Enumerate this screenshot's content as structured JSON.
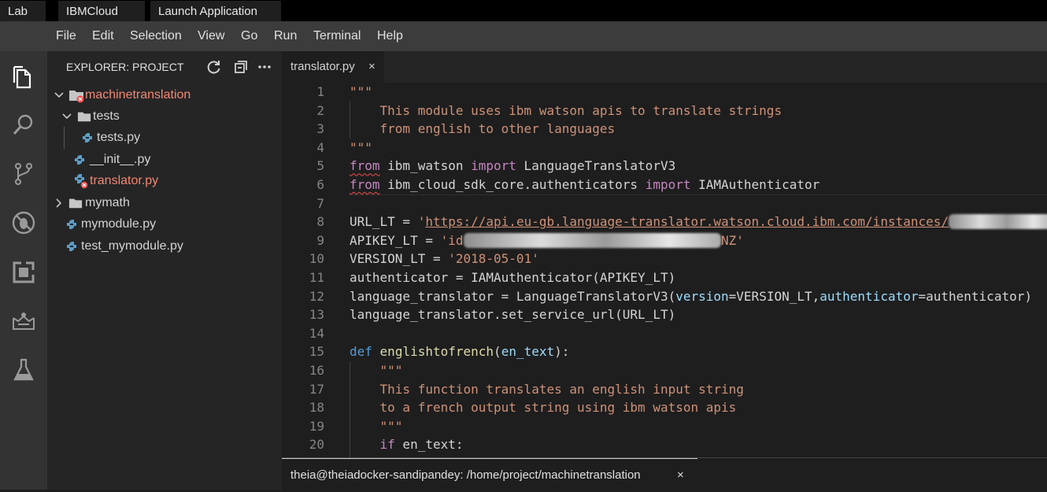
{
  "browser_tabs": [
    "Lab",
    "IBMCloud",
    "Launch Application"
  ],
  "menu": [
    "File",
    "Edit",
    "Selection",
    "View",
    "Go",
    "Run",
    "Terminal",
    "Help"
  ],
  "activity_icons": [
    "explorer-icon",
    "search-icon",
    "source-control-icon",
    "debug-icon",
    "extensions-icon",
    "toolbox-icon",
    "lab-flask-icon"
  ],
  "sidebar": {
    "title": "EXPLORER: PROJECT",
    "actions": [
      "refresh-icon",
      "collapse-all-icon",
      "more-icon"
    ],
    "tree": [
      {
        "label": "machinetranslation",
        "type": "folder",
        "expanded": true,
        "error": true
      },
      {
        "label": "tests",
        "type": "folder",
        "expanded": true,
        "error": false
      },
      {
        "label": "tests.py",
        "type": "python-file",
        "error": false
      },
      {
        "label": "__init__.py",
        "type": "python-file",
        "error": false
      },
      {
        "label": "translator.py",
        "type": "python-file",
        "error": true
      },
      {
        "label": "mymath",
        "type": "folder",
        "expanded": false,
        "error": false
      },
      {
        "label": "mymodule.py",
        "type": "python-file",
        "error": false
      },
      {
        "label": "test_mymodule.py",
        "type": "python-file",
        "error": false
      }
    ]
  },
  "editor": {
    "tab_label": "translator.py",
    "tab_close": "×",
    "lines": [
      {
        "n": "1",
        "text": "\"\"\""
      },
      {
        "n": "2",
        "text": "    This module uses ibm watson apis to translate strings"
      },
      {
        "n": "3",
        "text": "    from english to other languages"
      },
      {
        "n": "4",
        "text": "\"\"\""
      },
      {
        "n": "5",
        "text": "from ibm_watson import LanguageTranslatorV3"
      },
      {
        "n": "6",
        "text": "from ibm_cloud_sdk_core.authenticators import IAMAuthenticator"
      },
      {
        "n": "7",
        "text": ""
      },
      {
        "n": "8",
        "text": "URL_LT = 'https://api.eu-gb.language-translator.watson.cloud.ibm.com/instances/"
      },
      {
        "n": "9",
        "text": "APIKEY_LT = 'id"
      },
      {
        "n": "10",
        "text": "VERSION_LT = '2018-05-01'"
      },
      {
        "n": "11",
        "text": "authenticator = IAMAuthenticator(APIKEY_LT)"
      },
      {
        "n": "12",
        "text": "language_translator = LanguageTranslatorV3(version=VERSION_LT,authenticator=authenticator)"
      },
      {
        "n": "13",
        "text": "language_translator.set_service_url(URL_LT)"
      },
      {
        "n": "14",
        "text": ""
      },
      {
        "n": "15",
        "text": "def englishtofrench(en_text):"
      },
      {
        "n": "16",
        "text": "    \"\"\""
      },
      {
        "n": "17",
        "text": "    This function translates an english input string"
      },
      {
        "n": "18",
        "text": "    to a french output string using ibm watson apis"
      },
      {
        "n": "19",
        "text": "    \"\"\""
      },
      {
        "n": "20",
        "text": "    if en_text:"
      }
    ],
    "redacted_tail_line9": "NZ'",
    "colors": {
      "string": "#ce9178",
      "keyword": "#c586c0",
      "def": "#569cd6",
      "function": "#dcdcaa",
      "param": "#9cdcfe",
      "error": "#f14c4c"
    }
  },
  "terminal": {
    "tab_label": "theia@theiadocker-sandipandey: /home/project/machinetranslation",
    "close": "×"
  }
}
